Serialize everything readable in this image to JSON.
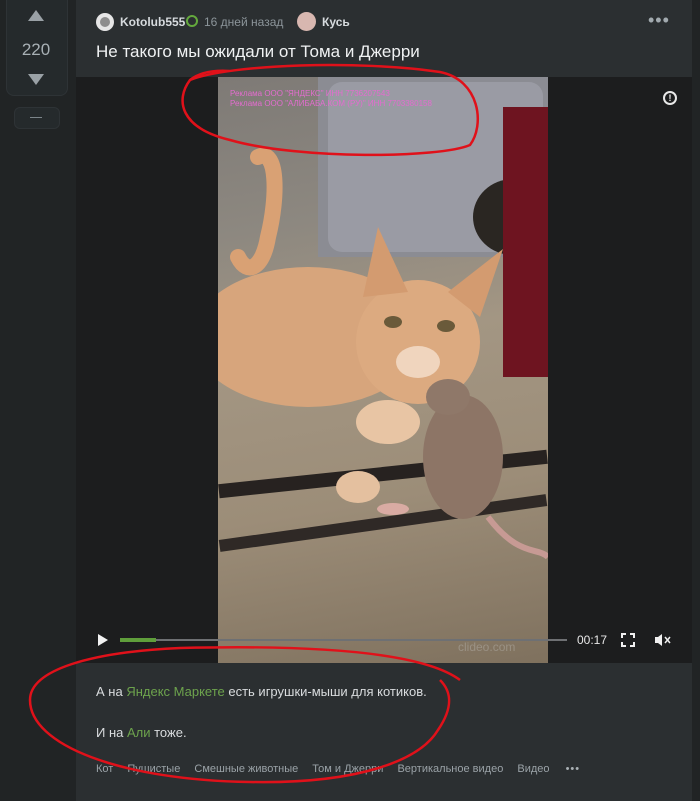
{
  "vote": {
    "count": "220"
  },
  "post": {
    "author": "Kotolub555",
    "time": "16 дней назад",
    "community": "Кусь",
    "title": "Не такого мы ожидали от Тома и Джерри"
  },
  "video": {
    "ad_lines": [
      "Реклама ООО \"ЯНДЕКС\" ИНН 7736207543",
      "Реклама ООО \"АЛИБАБА.КОМ (РУ)\" ИНН 7703380158"
    ],
    "duration": "00:17",
    "progress": 0.08,
    "watermark": "clideo.com",
    "info_glyph": "!"
  },
  "body": {
    "p1": {
      "before": "А на ",
      "link": "Яндекс Маркете",
      "after": " есть игрушки-мыши для котиков."
    },
    "p2": {
      "before": "И на ",
      "link": "Али",
      "after": " тоже."
    }
  },
  "tags": [
    "Кот",
    "Пушистые",
    "Смешные животные",
    "Том и Джерри",
    "Вертикальное видео",
    "Видео"
  ],
  "more_glyph": "•••",
  "icons": {
    "user_badge": "green-swirl-icon",
    "menu": "vertical-dots-icon",
    "play": "play-icon",
    "fullscreen": "fullscreen-icon",
    "mute": "mute-icon",
    "info": "info-icon"
  },
  "colors": {
    "accent_green": "#6da34d",
    "ad_text": "#e36ccf",
    "annotation": "#e0111a"
  }
}
